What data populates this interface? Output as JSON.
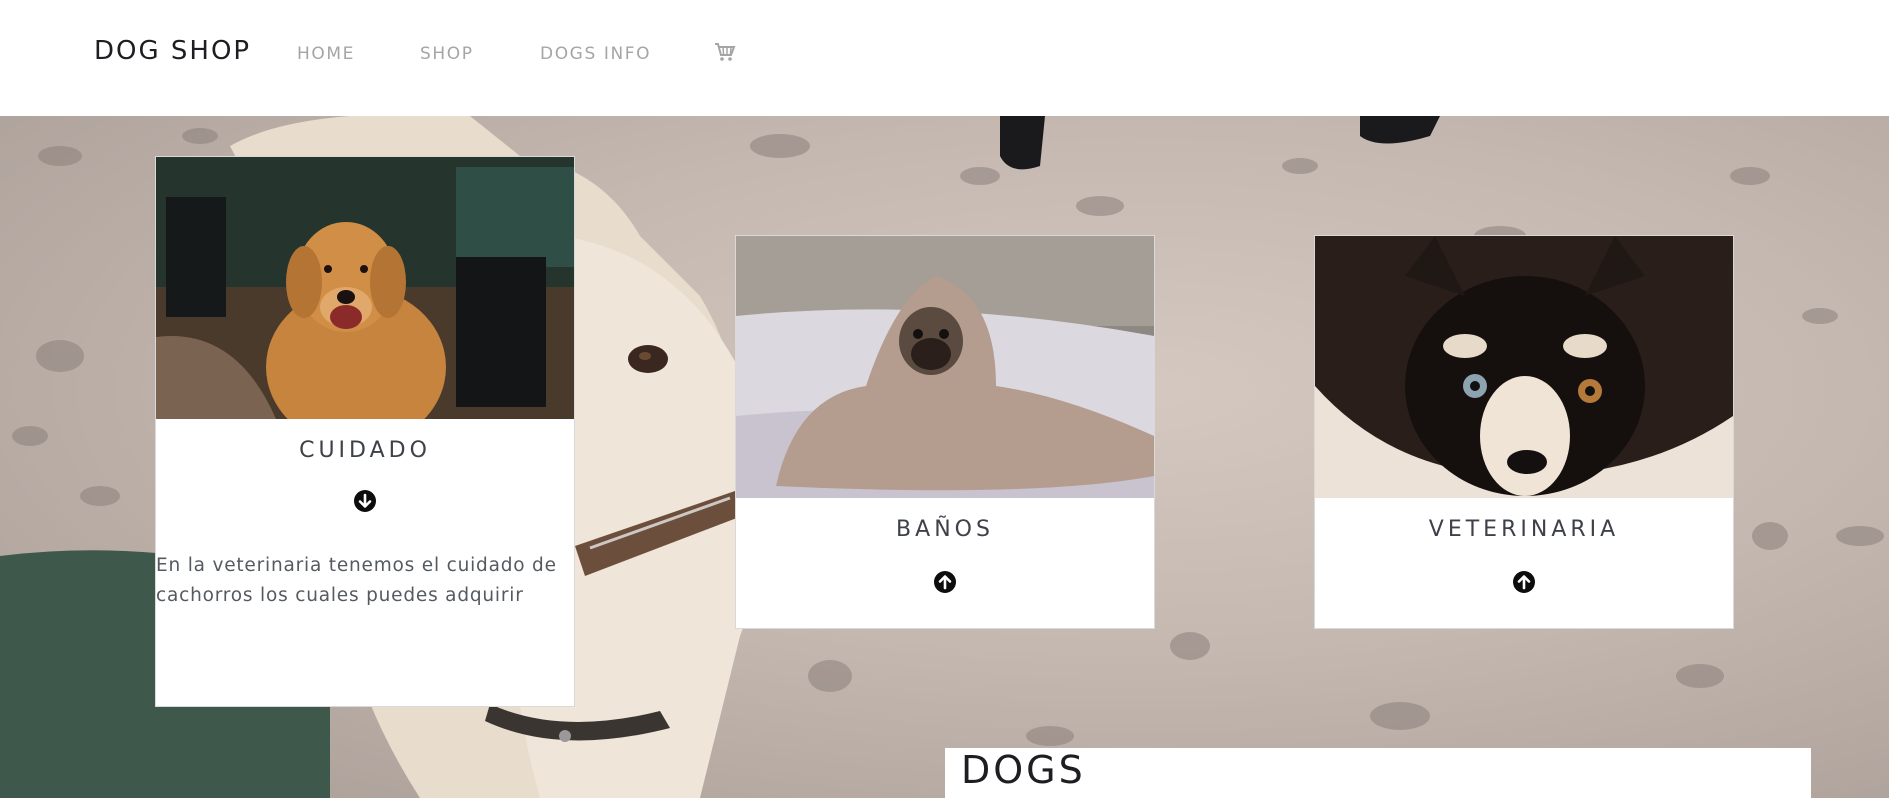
{
  "navbar": {
    "brand": "DOG SHOP",
    "links": [
      "HOME",
      "SHOP",
      "DOGS INFO"
    ],
    "cart_icon": "cart-icon"
  },
  "cards": [
    {
      "title": "CUIDADO",
      "button_icon": "arrow-down-circle-icon",
      "text": "En la veterinaria tenemos el cuidado de cachorros los cuales puedes adquirir"
    },
    {
      "title": "BAÑOS",
      "button_icon": "arrow-up-circle-icon"
    },
    {
      "title": "VETERINARIA",
      "button_icon": "arrow-up-circle-icon"
    }
  ],
  "section": {
    "heading": "DOGS"
  },
  "colors": {
    "brand_text": "#1e1e22",
    "nav_link": "#a5a5a5",
    "card_title": "#3e4148",
    "card_text": "#555a61"
  }
}
